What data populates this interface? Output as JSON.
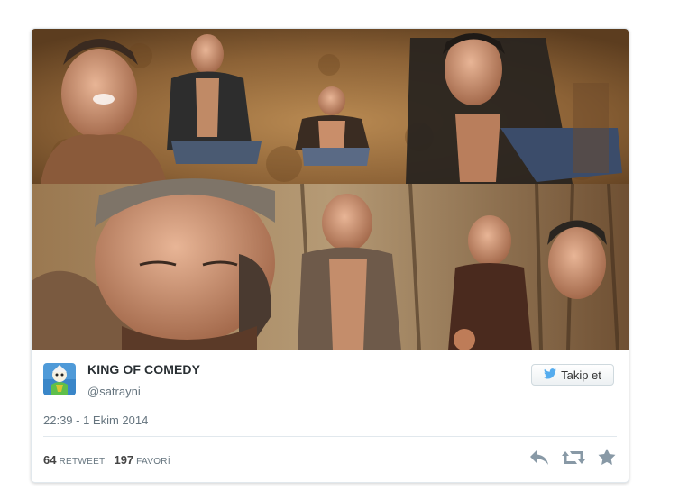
{
  "tweet": {
    "author_name": "KING OF COMEDY",
    "author_handle": "@satrayni",
    "follow_label": "Takip et",
    "timestamp": "22:39 - 1 Ekim 2014",
    "retweet_count": "64",
    "retweet_label": "RETWEET",
    "favorite_count": "197",
    "favorite_label": "FAVORİ"
  },
  "icons": {
    "follow": "twitter-bird-icon",
    "reply": "reply-icon",
    "retweet": "retweet-icon",
    "favorite": "star-icon"
  },
  "colors": {
    "twitter_blue": "#55acee",
    "action_gray": "#8899a6",
    "text_dark": "#292f33",
    "text_muted": "#66757f"
  }
}
